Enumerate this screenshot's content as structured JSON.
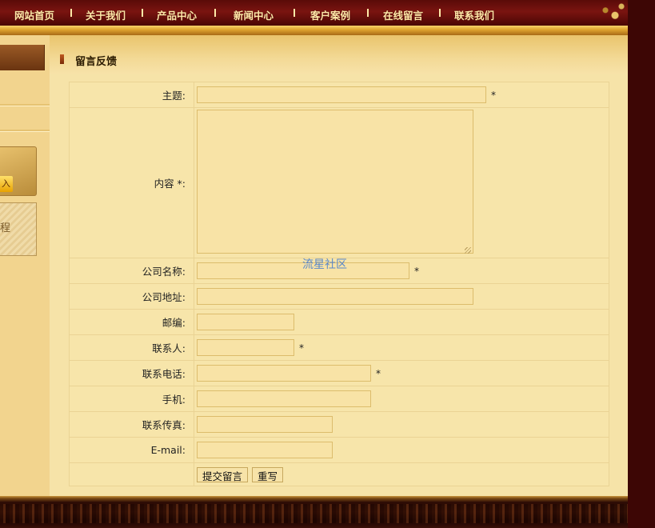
{
  "nav": {
    "items": [
      "网站首页",
      "关于我们",
      "产品中心",
      "新闻中心",
      "客户案例",
      "在线留言",
      "联系我们"
    ]
  },
  "sidebar": {
    "button_glyph": "入",
    "card_text": "程"
  },
  "page": {
    "title": "留言反馈"
  },
  "form": {
    "fields": [
      {
        "label": "主题:",
        "required": true
      },
      {
        "label": "内容 *:",
        "required": false
      },
      {
        "label": "公司名称:",
        "required": true
      },
      {
        "label": "公司地址:",
        "required": false
      },
      {
        "label": "邮编:",
        "required": false
      },
      {
        "label": "联系人:",
        "required": true
      },
      {
        "label": "联系电话:",
        "required": true
      },
      {
        "label": "手机:",
        "required": false
      },
      {
        "label": "联系传真:",
        "required": false
      },
      {
        "label": "E-mail:",
        "required": false
      }
    ],
    "required_mark": "*",
    "submit_label": "提交留言",
    "reset_label": "重写"
  },
  "watermark": "流星社区",
  "colors": {
    "nav_bg": "#6a0e0a",
    "nav_text": "#ffe9a8",
    "content_bg": "#f6e3a8",
    "input_border": "#dcbc6c"
  }
}
